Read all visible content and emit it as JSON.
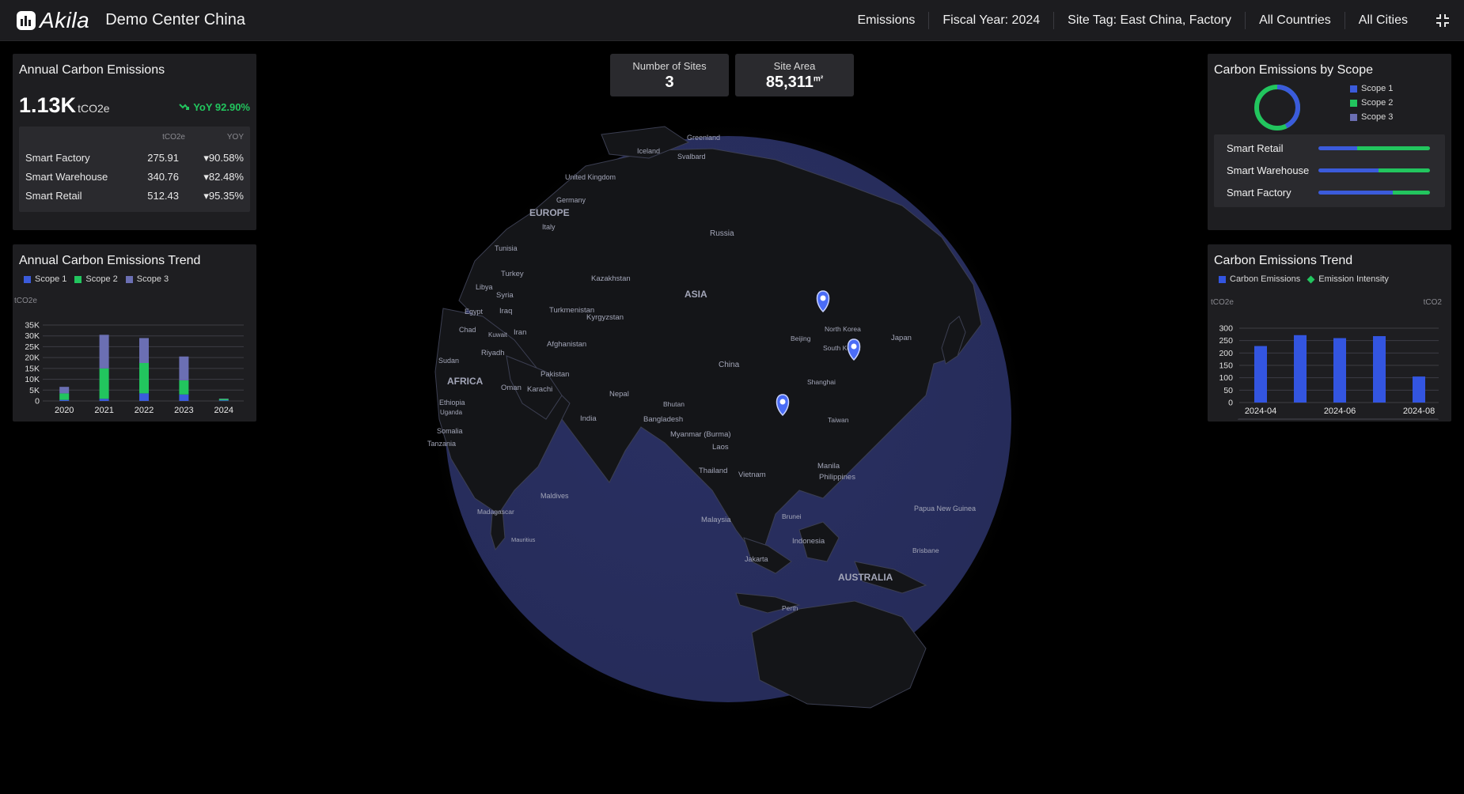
{
  "header": {
    "brand": "Akila",
    "app_title": "Demo Center China",
    "filters": [
      "Emissions",
      "Fiscal Year: 2024",
      "Site Tag: East China, Factory",
      "All Countries",
      "All Cities"
    ]
  },
  "kpis": {
    "sites_label": "Number of Sites",
    "sites_value": "3",
    "area_label": "Site Area",
    "area_value": "85,311",
    "area_unit": "m²"
  },
  "annual": {
    "title": "Annual Carbon Emissions",
    "value": "1.13K",
    "unit": "tCO2e",
    "yoy": "YoY 92.90%",
    "col_value": "tCO2e",
    "col_yoy": "YOY",
    "rows": [
      {
        "name": "Smart Factory",
        "value": "275.91",
        "yoy": "▾90.58%"
      },
      {
        "name": "Smart Warehouse",
        "value": "340.76",
        "yoy": "▾82.48%"
      },
      {
        "name": "Smart Retail",
        "value": "512.43",
        "yoy": "▾95.35%"
      }
    ]
  },
  "annual_trend": {
    "title": "Annual Carbon Emissions Trend",
    "legend": [
      "Scope 1",
      "Scope 2",
      "Scope 3"
    ],
    "unit": "tCO2e"
  },
  "scope": {
    "title": "Carbon Emissions by Scope",
    "legend": [
      "Scope 1",
      "Scope 2",
      "Scope 3"
    ],
    "rows": [
      {
        "name": "Smart Retail",
        "s1": 0.35,
        "s2": 0.65,
        "s3": 0.0
      },
      {
        "name": "Smart Warehouse",
        "s1": 0.54,
        "s2": 0.46,
        "s3": 0.0
      },
      {
        "name": "Smart Factory",
        "s1": 0.67,
        "s2": 0.33,
        "s3": 0.0
      }
    ]
  },
  "carbon_trend": {
    "title": "Carbon Emissions Trend",
    "legend": [
      "Carbon Emissions",
      "Emission Intensity"
    ],
    "unit_left": "tCO2e",
    "unit_right": "tCO2"
  },
  "colors": {
    "scope1": "#3b5bdb",
    "scope2": "#22c55e",
    "scope3": "#6b6fb3",
    "accent_green": "#22c55e",
    "bar_blue": "#3355e0"
  },
  "map_labels": [
    "Greenland",
    "Iceland",
    "Svalbard",
    "United Kingdom",
    "Germany",
    "EUROPE",
    "Italy",
    "Russia",
    "Tunisia",
    "Turkey",
    "Kazakhstan",
    "Libya",
    "Syria",
    "ASIA",
    "Iraq",
    "Turkmenistan",
    "Kyrgyzstan",
    "Egypt",
    "Chad",
    "Iran",
    "Kuwait",
    "Afghanistan",
    "North Korea",
    "Beijing",
    "Japan",
    "South Korea",
    "Riyadh",
    "Sudan",
    "China",
    "Pakistan",
    "Shanghai",
    "AFRICA",
    "Oman",
    "Karachi",
    "Nepal",
    "Ethiopia",
    "Bhutan",
    "Uganda",
    "India",
    "Bangladesh",
    "Taiwan",
    "Somalia",
    "Myanmar (Burma)",
    "Tanzania",
    "Laos",
    "Manila",
    "Thailand",
    "Vietnam",
    "Philippines",
    "Maldives",
    "Madagascar",
    "Malaysia",
    "Brunei",
    "Papua New Guinea",
    "Mauritius",
    "Indonesia",
    "Brisbane",
    "Jakarta",
    "AUSTRALIA",
    "Perth"
  ],
  "chart_data": [
    {
      "type": "bar",
      "stacked": true,
      "title": "Annual Carbon Emissions Trend",
      "categories": [
        "2020",
        "2021",
        "2022",
        "2023",
        "2024"
      ],
      "series": [
        {
          "name": "Scope 1",
          "values": [
            500,
            1000,
            3500,
            3000,
            300
          ]
        },
        {
          "name": "Scope 2",
          "values": [
            3000,
            14000,
            14000,
            6500,
            600
          ]
        },
        {
          "name": "Scope 3",
          "values": [
            3000,
            15500,
            11500,
            11000,
            200
          ]
        }
      ],
      "ylabel": "tCO2e",
      "yticks": [
        "0",
        "5K",
        "10K",
        "15K",
        "20K",
        "25K",
        "30K",
        "35K"
      ],
      "ylim": [
        0,
        35000
      ],
      "grid": true,
      "legend": "top-left"
    },
    {
      "type": "bar",
      "title": "Carbon Emissions Trend",
      "categories": [
        "2024-04",
        "2024-05",
        "2024-06",
        "2024-07",
        "2024-08"
      ],
      "tick_labels": [
        "2024-04",
        "2024-06",
        "2024-08"
      ],
      "series": [
        {
          "name": "Carbon Emissions",
          "values": [
            228,
            272,
            260,
            268,
            105
          ]
        }
      ],
      "ylabel": "tCO2e",
      "yticks": [
        "0",
        "50",
        "100",
        "150",
        "200",
        "250",
        "300"
      ],
      "ylim": [
        0,
        300
      ],
      "grid": true,
      "legend": "top-left"
    }
  ]
}
